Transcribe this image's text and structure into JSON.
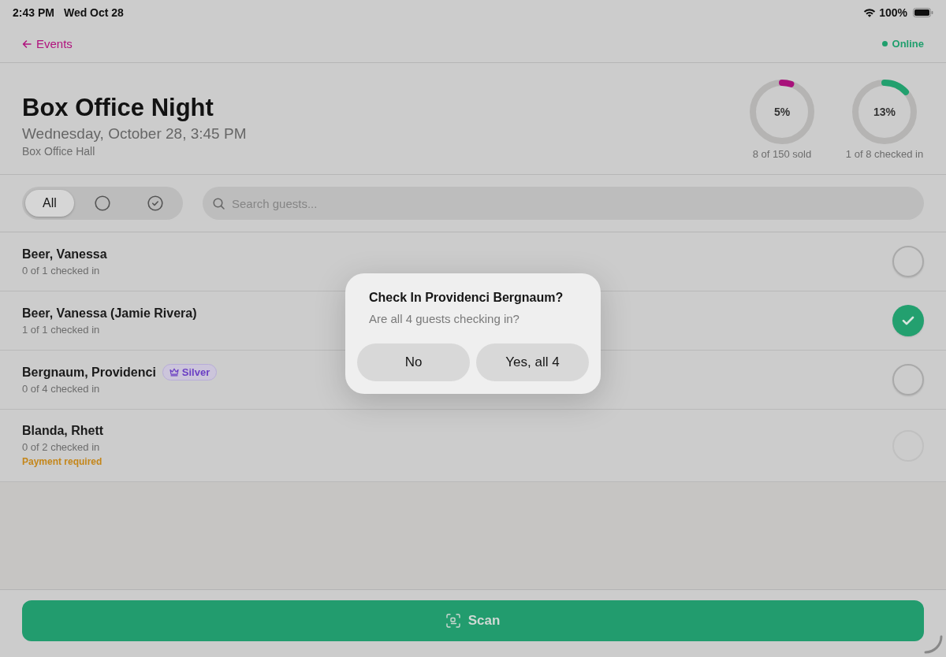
{
  "status_bar": {
    "time": "2:43 PM",
    "date": "Wed Oct 28",
    "battery": "100%"
  },
  "nav": {
    "back_label": "Events",
    "connection": "Online"
  },
  "event": {
    "title": "Box Office Night",
    "date": "Wednesday, October 28, 3:45 PM",
    "venue": "Box Office Hall"
  },
  "stats": [
    {
      "percent": "5%",
      "level": 0.05,
      "caption": "8 of 150 sold",
      "color": "#a8117b"
    },
    {
      "percent": "13%",
      "level": 0.13,
      "caption": "1 of 8 checked in",
      "color": "#22a06e"
    }
  ],
  "filters": [
    {
      "kind": "label",
      "label": "All",
      "selected": true
    },
    {
      "kind": "circle",
      "selected": false
    },
    {
      "kind": "check",
      "selected": false
    }
  ],
  "search": {
    "placeholder": "Search guests..."
  },
  "guests": [
    {
      "name": "Beer, Vanessa",
      "progress": "0 of 1 checked in",
      "checked": false,
      "disabled": false
    },
    {
      "name": "Beer, Vanessa (Jamie Rivera)",
      "progress": "1 of 1 checked in",
      "checked": true,
      "disabled": false
    },
    {
      "name": "Bergnaum, Providenci",
      "badge": "Silver",
      "progress": "0 of 4 checked in",
      "checked": false,
      "disabled": false
    },
    {
      "name": "Blanda, Rhett",
      "progress": "0 of 2 checked in",
      "warning": "Payment required",
      "checked": false,
      "disabled": true
    }
  ],
  "dialog": {
    "title": "Check In Providenci Bergnaum?",
    "message": "Are all 4 guests checking in?",
    "buttons": [
      "No",
      "Yes, all 4"
    ]
  },
  "scan_button": {
    "label": "Scan"
  }
}
